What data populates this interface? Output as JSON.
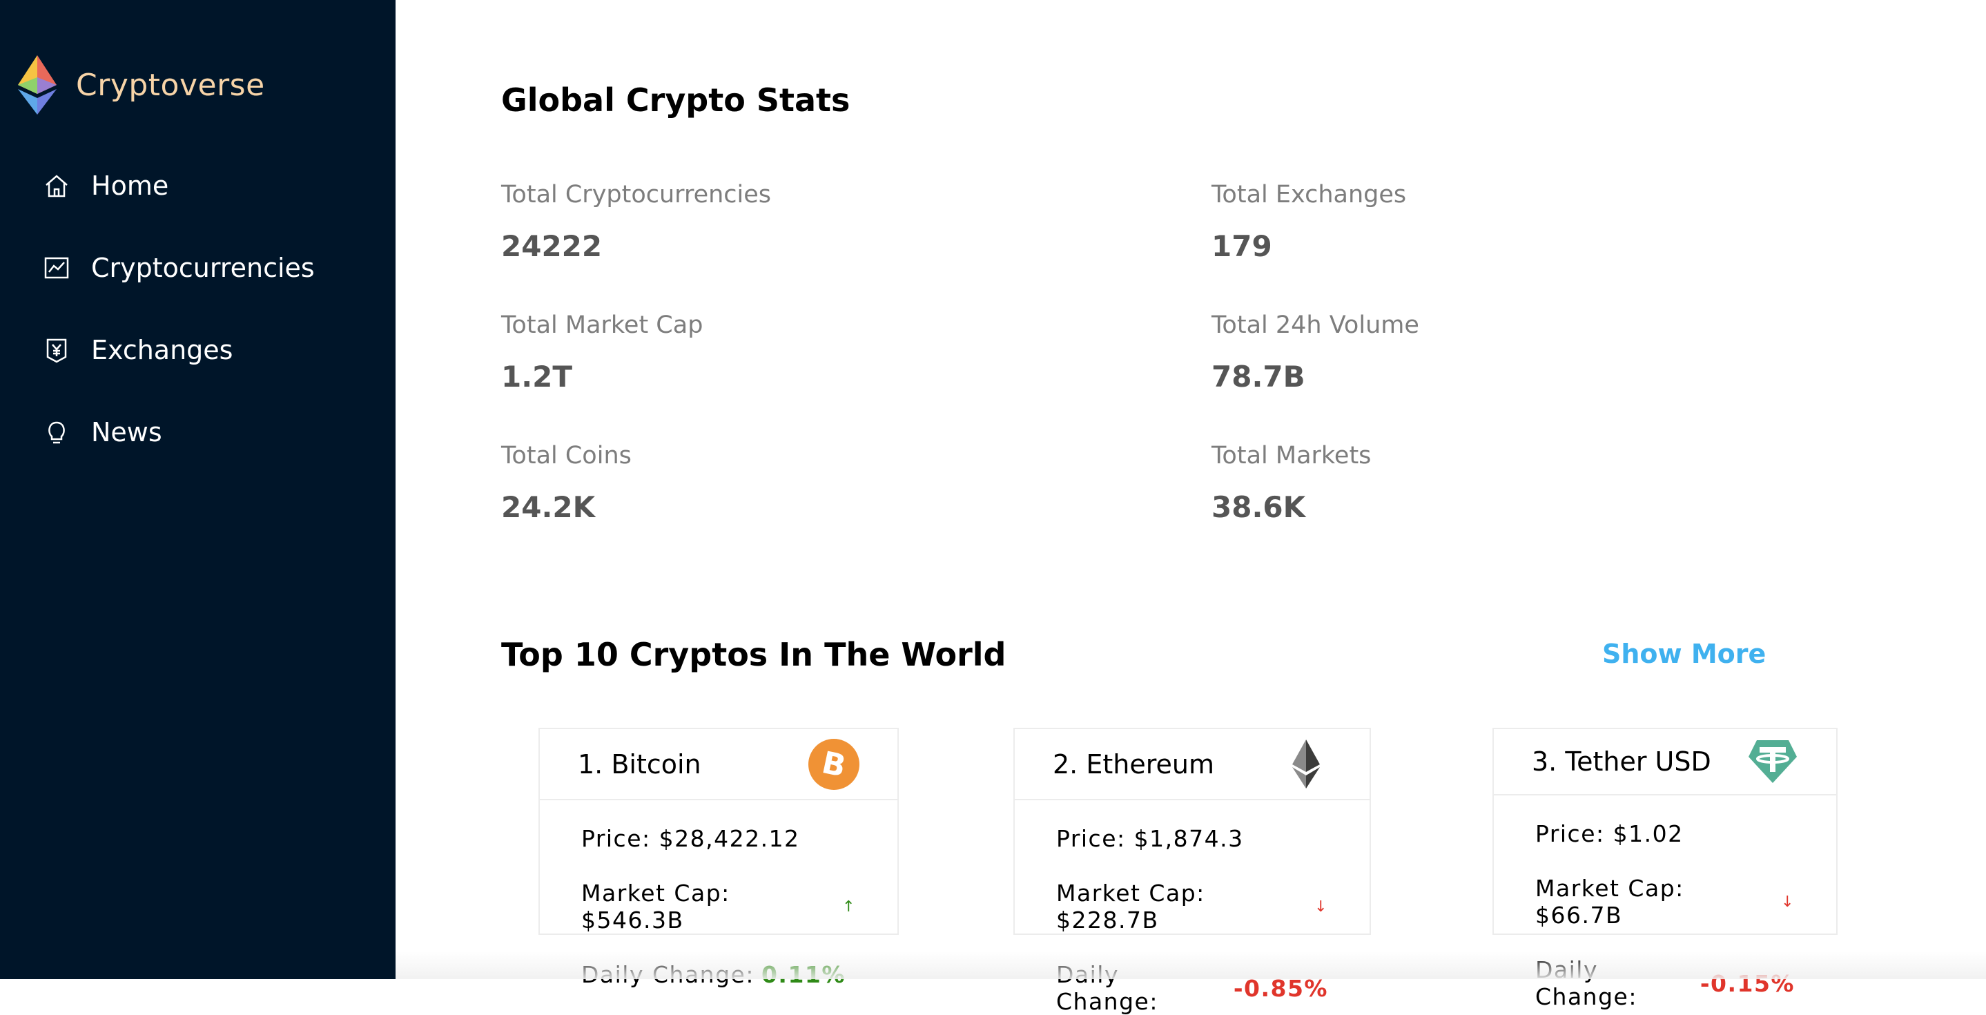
{
  "app": {
    "name": "Cryptoverse"
  },
  "nav": {
    "items": [
      {
        "label": "Home",
        "icon": "home-icon"
      },
      {
        "label": "Cryptocurrencies",
        "icon": "line-chart-icon"
      },
      {
        "label": "Exchanges",
        "icon": "money-collect-icon"
      },
      {
        "label": "News",
        "icon": "bulb-icon"
      }
    ]
  },
  "stats": {
    "title": "Global Crypto Stats",
    "items": [
      {
        "label": "Total Cryptocurrencies",
        "value": "24222"
      },
      {
        "label": "Total Exchanges",
        "value": "179"
      },
      {
        "label": "Total Market Cap",
        "value": "1.2T"
      },
      {
        "label": "Total 24h Volume",
        "value": "78.7B"
      },
      {
        "label": "Total Coins",
        "value": "24.2K"
      },
      {
        "label": "Total Markets",
        "value": "38.6K"
      }
    ]
  },
  "top": {
    "title": "Top 10 Cryptos In The World",
    "show_more": "Show More",
    "cards": [
      {
        "title": "1. Bitcoin",
        "price": "Price: $28,422.12",
        "market_cap": "Market Cap: $546.3B",
        "trend": "↑",
        "daily_label": "Daily Change:",
        "daily_value": "0.11%",
        "icon": "bitcoin-icon"
      },
      {
        "title": "2. Ethereum",
        "price": "Price: $1,874.3",
        "market_cap": "Market Cap: $228.7B",
        "trend": "↓",
        "daily_label": "Daily Change:",
        "daily_value": "-0.85%",
        "icon": "ethereum-icon"
      },
      {
        "title": "3. Tether USD",
        "price": "Price: $1.02",
        "market_cap": "Market Cap: $66.7B",
        "trend": "↓",
        "daily_label": "Daily Change:",
        "daily_value": "-0.15%",
        "icon": "tether-icon"
      }
    ]
  },
  "colors": {
    "sidebar_bg": "#001529",
    "logo_text": "#f7d4a8",
    "link": "#3fb1ef",
    "positive": "#2f8a17",
    "negative": "#e0352b",
    "bitcoin": "#f09235",
    "tether": "#53ae94"
  }
}
